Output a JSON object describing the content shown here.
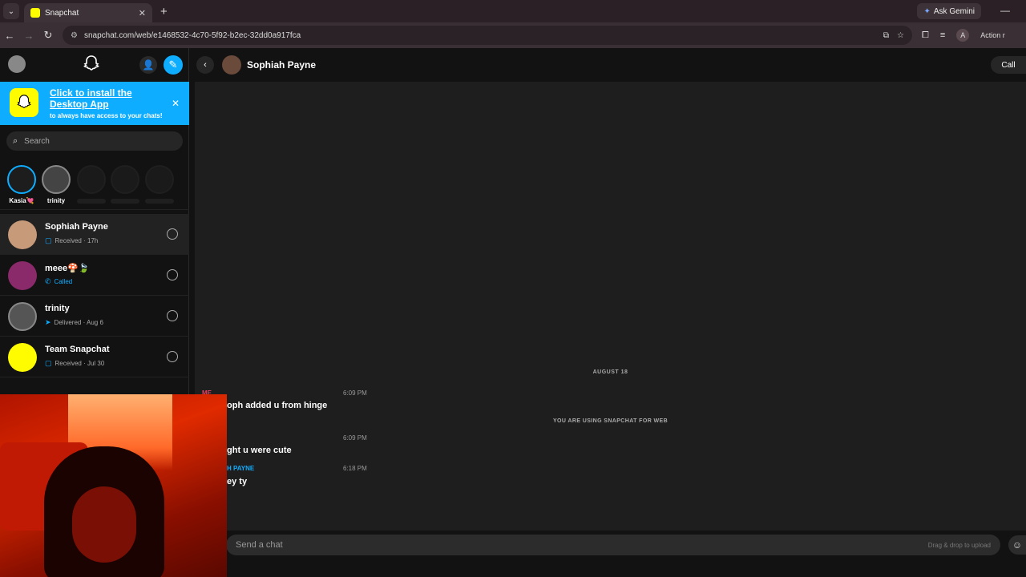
{
  "browser": {
    "tab_title": "Snapchat",
    "new_tab_icon": "plus-icon",
    "gemini_label": "Ask Gemini",
    "url": "snapchat.com/web/e1468532-4c70-5f92-b2ec-32dd0a917fca",
    "profile_initial": "A",
    "action_label": "Action r"
  },
  "banner": {
    "title": "Click to install the Desktop App",
    "subtitle": "to always have access to your chats!"
  },
  "search": {
    "placeholder": "Search"
  },
  "stories": [
    {
      "name": "Kasia💘"
    },
    {
      "name": "trinity"
    }
  ],
  "chats": [
    {
      "name": "Sophiah Payne",
      "status": "Received · 17h",
      "status_icon": "chat-received-icon",
      "status_color": "#0fadff"
    },
    {
      "name": "meee🍄🍃",
      "status": "Called",
      "status_icon": "phone-called-icon",
      "status_color": "#0fadff"
    },
    {
      "name": "trinity",
      "status": "Delivered · Aug 6",
      "status_icon": "delivered-arrow-icon",
      "status_color": "#0fadff"
    },
    {
      "name": "Team Snapchat",
      "status": "Received · Jul 30",
      "status_icon": "chat-received-icon",
      "status_color": "#0fadff"
    }
  ],
  "conversation": {
    "contact_name": "Sophiah Payne",
    "call_label": "Call",
    "date_separator": "AUGUST 18",
    "web_notice": "YOU ARE USING SNAPCHAT FOR WEB",
    "messages": [
      {
        "sender": "ME",
        "time": "6:09 PM",
        "text": "oph added u from hinge",
        "sender_color": "#e8415f"
      },
      {
        "sender": "",
        "time": "6:09 PM",
        "text": "ght u were cute",
        "sender_color": "#e8415f"
      },
      {
        "sender": "H PAYNE",
        "time": "6:18 PM",
        "text": "ey ty",
        "sender_color": "#0fadff"
      }
    ],
    "composer_placeholder": "Send a chat",
    "drag_hint": "Drag & drop to upload"
  },
  "colors": {
    "accent_blue": "#0fadff",
    "snap_yellow": "#fffc00",
    "me_red": "#e8415f"
  }
}
